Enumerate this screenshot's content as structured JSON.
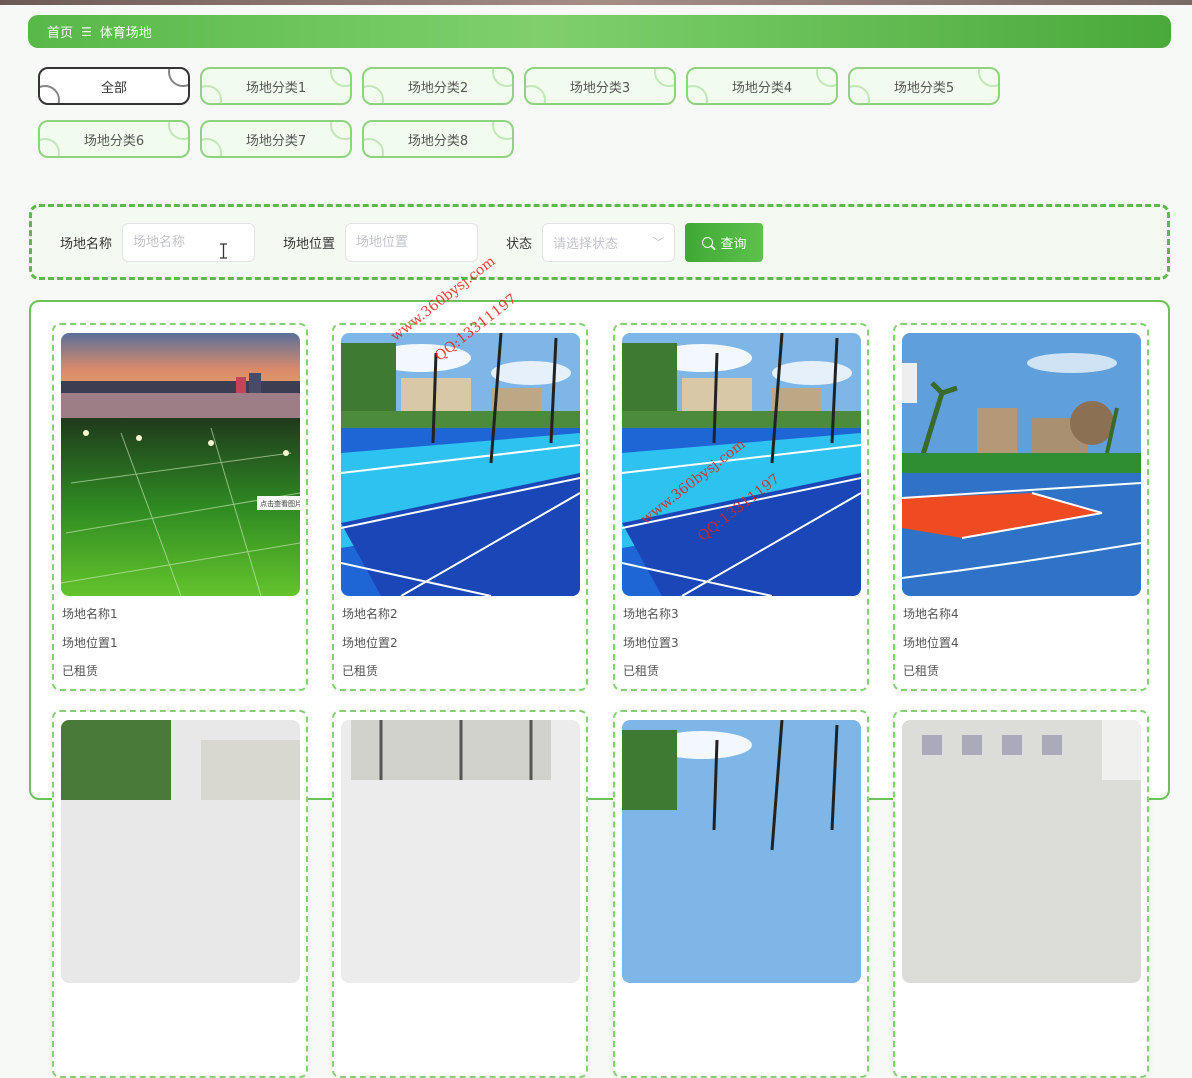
{
  "breadcrumb": {
    "home": "首页",
    "separator": "☰",
    "current": "体育场地"
  },
  "categories": [
    {
      "label": "全部",
      "active": true
    },
    {
      "label": "场地分类1"
    },
    {
      "label": "场地分类2"
    },
    {
      "label": "场地分类3"
    },
    {
      "label": "场地分类4"
    },
    {
      "label": "场地分类5"
    },
    {
      "label": "场地分类6"
    },
    {
      "label": "场地分类7"
    },
    {
      "label": "场地分类8"
    }
  ],
  "search": {
    "name_label": "场地名称",
    "name_placeholder": "场地名称",
    "location_label": "场地位置",
    "location_placeholder": "场地位置",
    "status_label": "状态",
    "status_placeholder": "请选择状态",
    "query_label": "查询"
  },
  "venues": [
    {
      "name": "场地名称1",
      "location": "场地位置1",
      "status": "已租赁",
      "scene": "football"
    },
    {
      "name": "场地名称2",
      "location": "场地位置2",
      "status": "已租赁",
      "scene": "tennis"
    },
    {
      "name": "场地名称3",
      "location": "场地位置3",
      "status": "已租赁",
      "scene": "tennis"
    },
    {
      "name": "场地名称4",
      "location": "场地位置4",
      "status": "已租赁",
      "scene": "basketball"
    }
  ],
  "photo_caption": "点击查看图片",
  "watermarks": {
    "site": "www.360bysj.com",
    "qq": "QQ:13311197"
  },
  "colors": {
    "accent": "#5cb84a",
    "status_rented": "#555555"
  }
}
